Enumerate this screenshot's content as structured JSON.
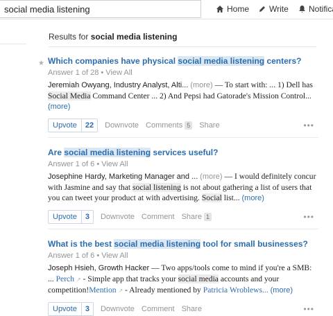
{
  "search": {
    "value": "social media listening"
  },
  "nav": {
    "home": "Home",
    "write": "Write",
    "notifications": "Notificat"
  },
  "results_header": {
    "prefix": "Results for",
    "query": "social media listening"
  },
  "results": [
    {
      "title_parts": [
        "Which companies have physical ",
        "social media listening",
        " centers?"
      ],
      "meta": "Answer 1 of 28 • View All",
      "author": "Jeremiah Owyang, Industry Analyst, Alti...",
      "more": "(more)",
      "body_parts": [
        " — To start with: ... 1) Dell has ",
        "Social Media",
        " Command Center ... 2) And Pepsi had Gatorade's Mission Control... "
      ],
      "more_link": "(more)",
      "upvote_label": "Upvote",
      "upvote_count": "22",
      "downvote": "Downvote",
      "comment_label": "Comments",
      "comment_count": "5",
      "share_label": "Share",
      "share_count": ""
    },
    {
      "title_parts": [
        "Are ",
        "social media listening",
        " services useful?"
      ],
      "meta": "Answer 1 of 6 • View All",
      "author": "Josephine Hardy, Marketing Manager and ...",
      "more": "(more)",
      "body_parts": [
        " — I would definitely concur with Jasmine and say that ",
        "social listening",
        " is not about gathering a list of users that you can tweet your product at with advertising. ",
        "Social",
        " list... "
      ],
      "more_link": "(more)",
      "upvote_label": "Upvote",
      "upvote_count": "3",
      "downvote": "Downvote",
      "comment_label": "Comment",
      "comment_count": "",
      "share_label": "Share",
      "share_count": "1"
    },
    {
      "title_parts": [
        "What is the best ",
        "social media listening",
        " tool for small businesses?"
      ],
      "meta": "Answer 1 of 6 • View All",
      "author": "Joseph Hsieh, Growth Hacker",
      "body_parts": [
        " — Two apps/tools come to mind if you're a SMB: ... ",
        "Perch",
        " - Simple app that tracks your ",
        "social media",
        " accounts and your competition!",
        "Mention",
        " - Already mentioned by ",
        "Patricia Wroblews...",
        " "
      ],
      "more_link": "(more)",
      "upvote_label": "Upvote",
      "upvote_count": "3",
      "downvote": "Downvote",
      "comment_label": "Comment",
      "share_label": "Share"
    }
  ],
  "colors": {
    "link": "#2b6dad",
    "highlight": "#dce7f4",
    "muted": "#949494"
  },
  "icons": [
    "home-icon",
    "pencil-icon",
    "bell-icon",
    "star-icon",
    "external-link-icon",
    "more-dots-icon"
  ]
}
